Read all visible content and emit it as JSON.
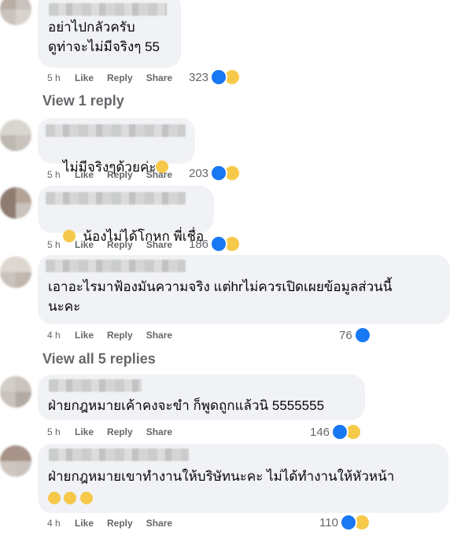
{
  "comments": [
    {
      "text": "อย่าไปกลัวครับ\nดูท่าจะไม่มีจริงๆ 55",
      "time": "5 h",
      "like": "Like",
      "reply": "Reply",
      "share": "Share",
      "count": "323",
      "reactions": [
        "like",
        "haha"
      ]
    },
    {
      "text": "ไม่มีจริงๆด้วยค่ะ",
      "time": "5 h",
      "like": "Like",
      "reply": "Reply",
      "share": "Share",
      "count": "203",
      "reactions": [
        "like",
        "haha"
      ]
    },
    {
      "text": "น้องไม่ได้โกหก พี่เชื่อ",
      "time": "5 h",
      "like": "Like",
      "reply": "Reply",
      "share": "Share",
      "count": "186",
      "reactions": [
        "like",
        "haha"
      ]
    },
    {
      "text": "เอาอะไรมาฟ้องมันความจริง แต่hrไม่ควรเปิดเผยข้อมูลส่วนนี้\nนะคะ",
      "time": "4 h",
      "like": "Like",
      "reply": "Reply",
      "share": "Share",
      "count": "76",
      "reactions": [
        "like"
      ]
    },
    {
      "text": "ฝ่ายกฎหมายเค้าคงจะขำ ก็พูดถูกแล้วนิ 5555555",
      "time": "5 h",
      "like": "Like",
      "reply": "Reply",
      "share": "Share",
      "count": "146",
      "reactions": [
        "like",
        "haha"
      ]
    },
    {
      "text": "ฝ่ายกฎหมายเขาทำงานให้บริษัทนะคะ ไม่ได้ทำงานให้หัวหน้า",
      "time": "4 h",
      "like": "Like",
      "reply": "Reply",
      "share": "Share",
      "count": "110",
      "reactions": [
        "like",
        "haha"
      ]
    }
  ],
  "view_reply_1": "View 1 reply",
  "view_replies_2": "View all 5 replies",
  "colors": {
    "bubble": "#f0f2f5",
    "like": "#1877f2",
    "haha": "#f7c94a",
    "meta": "#65676b"
  },
  "icons": {
    "like": "thumbs-up-icon",
    "haha": "laughing-face-icon"
  }
}
